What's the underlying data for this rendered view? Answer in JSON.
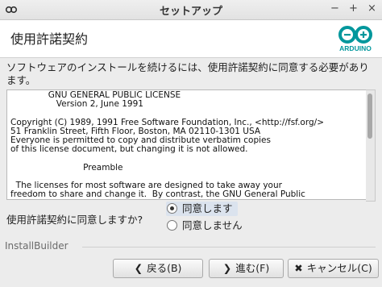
{
  "window": {
    "title": "セットアップ",
    "minimize": "−",
    "maximize": "+",
    "close": "×"
  },
  "header": {
    "title": "使用許諾契約",
    "logo_text": "ARDUINO"
  },
  "intro_text": "ソフトウェアのインストールを続けるには、使用許諾契約に同意する必要があります。",
  "license": {
    "text": "              GNU GENERAL PUBLIC LICENSE\n                 Version 2, June 1991\n\nCopyright (C) 1989, 1991 Free Software Foundation, Inc., <http://fsf.org/>\n51 Franklin Street, Fifth Floor, Boston, MA 02110-1301 USA\nEveryone is permitted to copy and distribute verbatim copies\nof this license document, but changing it is not allowed.\n\n                           Preamble\n\n  The licenses for most software are designed to take away your\nfreedom to share and change it.  By contrast, the GNU General Public"
  },
  "agreement": {
    "question": "使用許諾契約に同意しますか?",
    "options": [
      {
        "label": "同意します",
        "selected": true
      },
      {
        "label": "同意しません",
        "selected": false
      }
    ]
  },
  "footer": {
    "brand": "InstallBuilder",
    "back_icon": "❮",
    "back_label": "戻る(B)",
    "next_icon": "❯",
    "next_label": "進む(F)",
    "cancel_icon": "✖",
    "cancel_label": "キャンセル(C)"
  },
  "colors": {
    "arduino_teal": "#00979c",
    "selection": "#dbe3ee"
  }
}
